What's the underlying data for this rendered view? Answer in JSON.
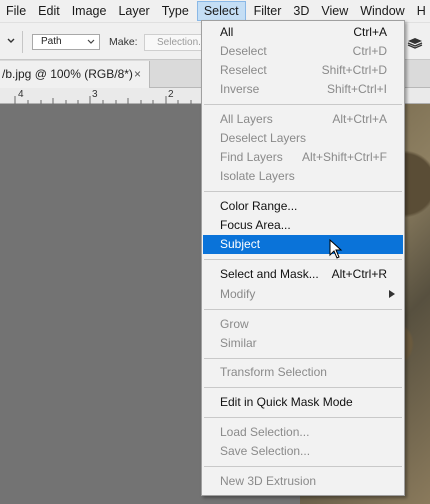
{
  "menubar": {
    "items": [
      "File",
      "Edit",
      "Image",
      "Layer",
      "Type",
      "Select",
      "Filter",
      "3D",
      "View",
      "Window",
      "H"
    ]
  },
  "options_bar": {
    "path_mode": "Path",
    "make_label": "Make:",
    "selection_button": "Selection..."
  },
  "document": {
    "tab_title": "/b.jpg @ 100% (RGB/8*)",
    "close_glyph": "×"
  },
  "ruler": {
    "ticks": [
      "4",
      "3",
      "2"
    ]
  },
  "select_menu": {
    "groups": [
      [
        {
          "label": "All",
          "shortcut": "Ctrl+A",
          "enabled": true
        },
        {
          "label": "Deselect",
          "shortcut": "Ctrl+D",
          "enabled": false
        },
        {
          "label": "Reselect",
          "shortcut": "Shift+Ctrl+D",
          "enabled": false
        },
        {
          "label": "Inverse",
          "shortcut": "Shift+Ctrl+I",
          "enabled": false
        }
      ],
      [
        {
          "label": "All Layers",
          "shortcut": "Alt+Ctrl+A",
          "enabled": false
        },
        {
          "label": "Deselect Layers",
          "shortcut": "",
          "enabled": false
        },
        {
          "label": "Find Layers",
          "shortcut": "Alt+Shift+Ctrl+F",
          "enabled": false
        },
        {
          "label": "Isolate Layers",
          "shortcut": "",
          "enabled": false
        }
      ],
      [
        {
          "label": "Color Range...",
          "shortcut": "",
          "enabled": true
        },
        {
          "label": "Focus Area...",
          "shortcut": "",
          "enabled": true
        },
        {
          "label": "Subject",
          "shortcut": "",
          "enabled": true,
          "highlighted": true
        }
      ],
      [
        {
          "label": "Select and Mask...",
          "shortcut": "Alt+Ctrl+R",
          "enabled": true
        },
        {
          "label": "Modify",
          "shortcut": "",
          "enabled": false,
          "submenu": true
        }
      ],
      [
        {
          "label": "Grow",
          "shortcut": "",
          "enabled": false
        },
        {
          "label": "Similar",
          "shortcut": "",
          "enabled": false
        }
      ],
      [
        {
          "label": "Transform Selection",
          "shortcut": "",
          "enabled": false
        }
      ],
      [
        {
          "label": "Edit in Quick Mask Mode",
          "shortcut": "",
          "enabled": true
        }
      ],
      [
        {
          "label": "Load Selection...",
          "shortcut": "",
          "enabled": false
        },
        {
          "label": "Save Selection...",
          "shortcut": "",
          "enabled": false
        }
      ],
      [
        {
          "label": "New 3D Extrusion",
          "shortcut": "",
          "enabled": false
        }
      ]
    ]
  },
  "colors": {
    "highlight": "#0a73d9",
    "menu_bg": "#f2f2f2",
    "canvas_bg": "#737373"
  },
  "icons": [
    "chevron-down-icon",
    "layers-icon",
    "plus-icon",
    "close-icon",
    "submenu-arrow-icon",
    "mouse-cursor-icon"
  ]
}
